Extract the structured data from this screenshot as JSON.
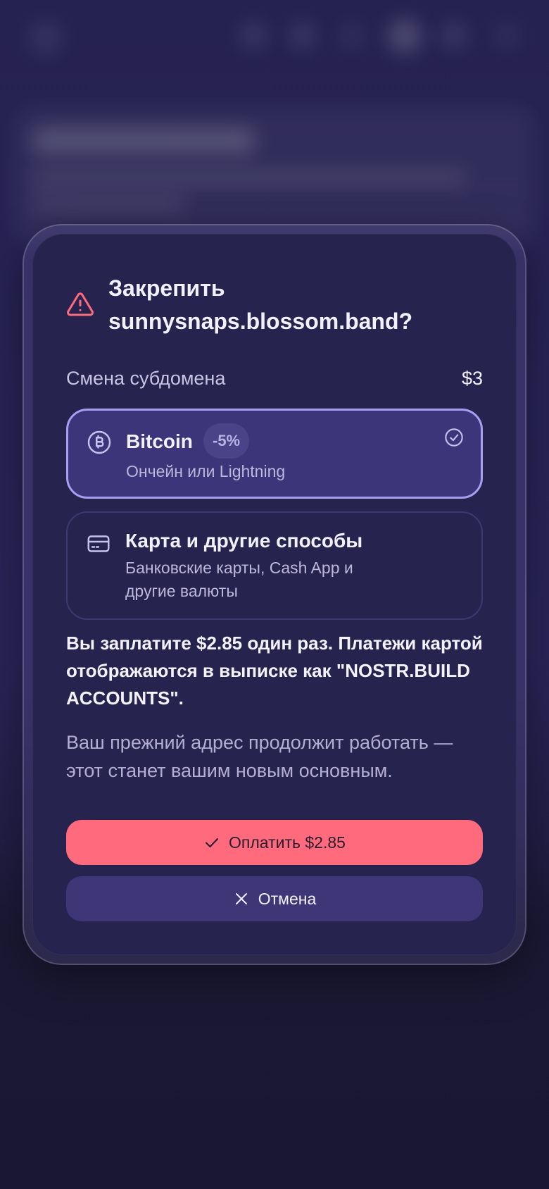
{
  "dialog": {
    "title": "Закрепить sunnysnaps.blossom.band?",
    "subdomain_label": "Смена субдомена",
    "subdomain_price": "$3"
  },
  "payment_options": [
    {
      "title": "Bitcoin",
      "badge": "-5%",
      "subtitle": "Ончейн или Lightning",
      "icon": "bitcoin-icon",
      "selected": true
    },
    {
      "title": "Карта и другие способы",
      "subtitle": "Банковские карты, Cash App и другие валюты",
      "icon": "credit-card-icon",
      "selected": false
    }
  ],
  "pay_note": "Вы заплатите $2.85 один раз. Платежи картой отображаются в выписке как \"NOSTR.BUILD ACCOUNTS\".",
  "info_note": "Ваш прежний адрес продолжит работать — этот станет вашим новым основным.",
  "buttons": {
    "pay_label": "Оплатить $2.85",
    "cancel_label": "Отмена"
  },
  "colors": {
    "accent": "#ff6b7d",
    "selected_border": "#a99ff0",
    "dialog_bg": "#27234f",
    "warning": "#ff6b7d"
  }
}
